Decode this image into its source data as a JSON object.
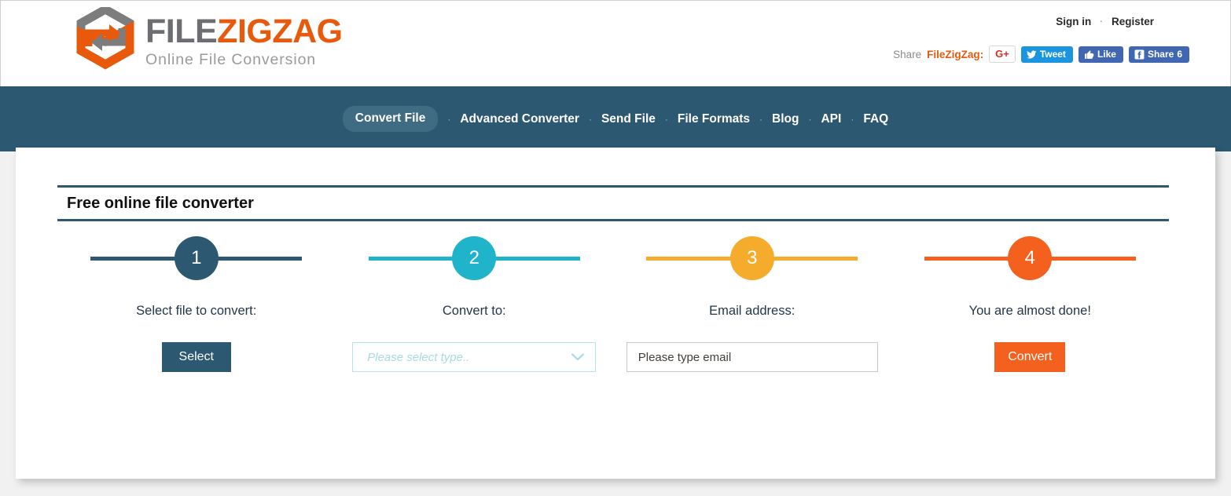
{
  "header": {
    "logo": {
      "brand_part1": "FILE",
      "brand_part2": "ZIGZAG",
      "tagline": "Online File Conversion",
      "color_gray": "#6d6e71",
      "color_orange": "#e8590c"
    },
    "account": {
      "sign_in": "Sign in",
      "separator": "·",
      "register": "Register"
    },
    "share": {
      "label": "Share",
      "brand": "FileZigZag:",
      "gplus_label": "G+",
      "tweet_label": "Tweet",
      "like_label": "Like",
      "fb_share_label": "Share",
      "fb_share_count": "6"
    }
  },
  "nav": {
    "background": "#2d5871",
    "items": [
      {
        "label": "Convert File",
        "active": true
      },
      {
        "label": "Advanced Converter",
        "active": false
      },
      {
        "label": "Send File",
        "active": false
      },
      {
        "label": "File Formats",
        "active": false
      },
      {
        "label": "Blog",
        "active": false
      },
      {
        "label": "API",
        "active": false
      },
      {
        "label": "FAQ",
        "active": false
      }
    ],
    "separator": "·"
  },
  "main": {
    "heading": "Free online file converter",
    "steps": [
      {
        "number": "1",
        "label": "Select file to convert:",
        "color": "#2d5871",
        "control": "button",
        "button_label": "Select"
      },
      {
        "number": "2",
        "label": "Convert to:",
        "color": "#1fb4c9",
        "control": "select",
        "select_placeholder": "Please select type.."
      },
      {
        "number": "3",
        "label": "Email address:",
        "color": "#f5ab2b",
        "control": "input",
        "input_placeholder": "Please type email",
        "input_value": ""
      },
      {
        "number": "4",
        "label": "You are almost done!",
        "color": "#f4601e",
        "control": "button",
        "button_label": "Convert"
      }
    ]
  }
}
